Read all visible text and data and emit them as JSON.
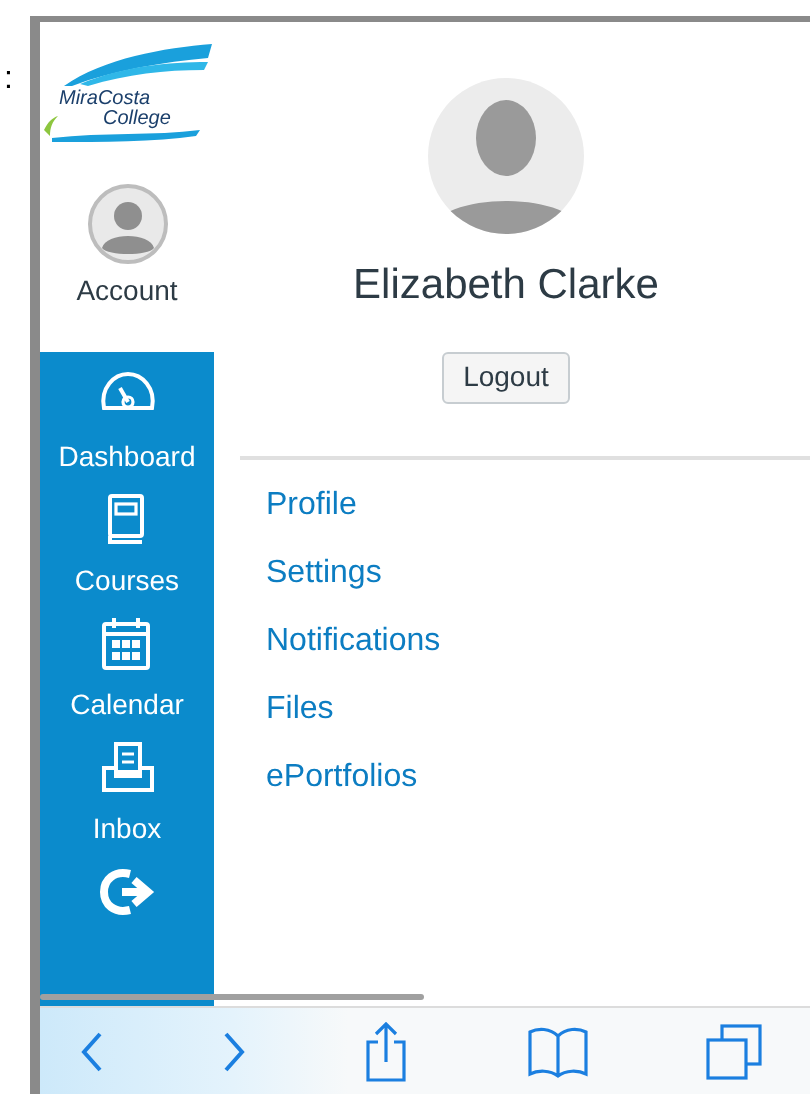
{
  "edge_mark": ":",
  "logo": {
    "line1": "MiraCosta",
    "line2": "College"
  },
  "sidebar": {
    "account": {
      "label": "Account"
    },
    "items": [
      {
        "kind": "dashboard",
        "label": "Dashboard"
      },
      {
        "kind": "courses",
        "label": "Courses"
      },
      {
        "kind": "calendar",
        "label": "Calendar"
      },
      {
        "kind": "inbox",
        "label": "Inbox"
      },
      {
        "kind": "logout"
      }
    ]
  },
  "profile": {
    "name": "Elizabeth Clarke",
    "logout_button": "Logout"
  },
  "links": [
    "Profile",
    "Settings",
    "Notifications",
    "Files",
    "ePortfolios"
  ],
  "browser_toolbar": {
    "back_enabled": true,
    "forward_enabled": true
  }
}
